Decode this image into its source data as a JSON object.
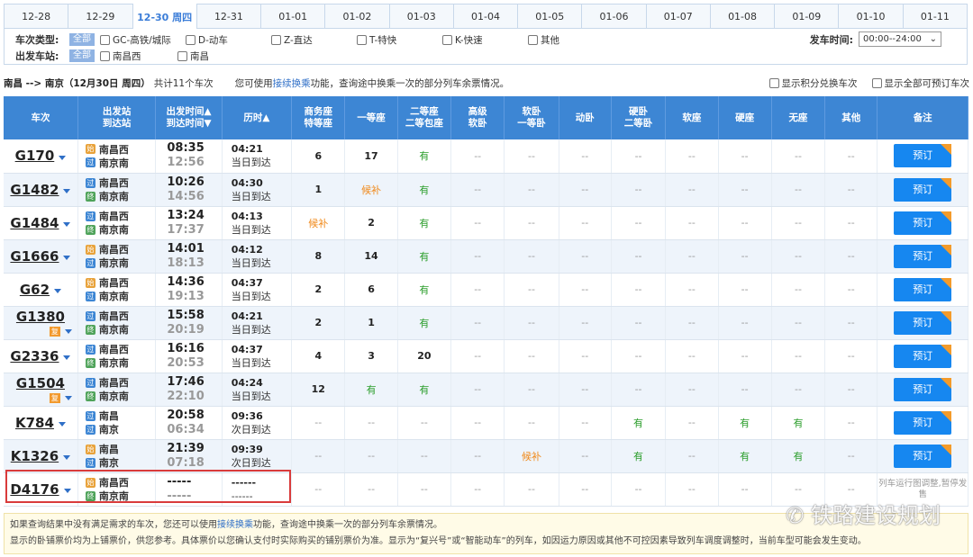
{
  "dates": [
    "12-28",
    "12-29",
    "12-30 周四",
    "12-31",
    "01-01",
    "01-02",
    "01-03",
    "01-04",
    "01-05",
    "01-06",
    "01-07",
    "01-08",
    "01-09",
    "01-10",
    "01-11"
  ],
  "filters": {
    "type_label": "车次类型:",
    "all": "全部",
    "types": [
      "GC-高铁/城际",
      "D-动车",
      "Z-直达",
      "T-特快",
      "K-快速",
      "其他"
    ],
    "station_label": "出发车站:",
    "stations": [
      "南昌西",
      "南昌"
    ],
    "time_label": "发车时间:",
    "time_value": "00:00--24:00"
  },
  "summary": {
    "route": "南昌 --> 南京（12月30日 周四）",
    "count": "共计11个车次",
    "hint_pre": "您可使用",
    "hint_link": "接续换乘",
    "hint_post": "功能，查询途中换乘一次的部分列车余票情况。",
    "opt1": "显示积分兑换车次",
    "opt2": "显示全部可预订车次"
  },
  "headers": {
    "train": "车次",
    "station1": "出发站",
    "station2": "到达站",
    "time1": "出发时间▲",
    "time2": "到达时间▼",
    "dur": "历时▲",
    "biz1": "商务座",
    "biz2": "特等座",
    "first": "一等座",
    "second1": "二等座",
    "second2": "二等包座",
    "gr1": "高级",
    "gr2": "软卧",
    "rw1": "软卧",
    "rw2": "一等卧",
    "dw": "动卧",
    "yw1": "硬卧",
    "yw2": "二等卧",
    "rz": "软座",
    "yz": "硬座",
    "wz": "无座",
    "qt": "其他",
    "note": "备注"
  },
  "book_label": "预订",
  "rows": [
    {
      "train": "G170",
      "fu": "",
      "from": "南昌西",
      "to": "南京南",
      "fb": "始",
      "tb": "过",
      "dep": "08:35",
      "arr": "12:56",
      "dur": "04:21",
      "day": "当日到达",
      "seats": [
        "6",
        "17",
        "有",
        "--",
        "--",
        "--",
        "--",
        "--",
        "--",
        "--",
        "--"
      ],
      "note": ""
    },
    {
      "train": "G1482",
      "fu": "",
      "from": "南昌西",
      "to": "南京南",
      "fb": "过",
      "tb": "终",
      "dep": "10:26",
      "arr": "14:56",
      "dur": "04:30",
      "day": "当日到达",
      "seats": [
        "1",
        "候补",
        "有",
        "--",
        "--",
        "--",
        "--",
        "--",
        "--",
        "--",
        "--"
      ],
      "note": ""
    },
    {
      "train": "G1484",
      "fu": "",
      "from": "南昌西",
      "to": "南京南",
      "fb": "过",
      "tb": "终",
      "dep": "13:24",
      "arr": "17:37",
      "dur": "04:13",
      "day": "当日到达",
      "seats": [
        "候补",
        "2",
        "有",
        "--",
        "--",
        "--",
        "--",
        "--",
        "--",
        "--",
        "--"
      ],
      "note": ""
    },
    {
      "train": "G1666",
      "fu": "",
      "from": "南昌西",
      "to": "南京南",
      "fb": "始",
      "tb": "过",
      "dep": "14:01",
      "arr": "18:13",
      "dur": "04:12",
      "day": "当日到达",
      "seats": [
        "8",
        "14",
        "有",
        "--",
        "--",
        "--",
        "--",
        "--",
        "--",
        "--",
        "--"
      ],
      "note": ""
    },
    {
      "train": "G62",
      "fu": "",
      "from": "南昌西",
      "to": "南京南",
      "fb": "始",
      "tb": "过",
      "dep": "14:36",
      "arr": "19:13",
      "dur": "04:37",
      "day": "当日到达",
      "seats": [
        "2",
        "6",
        "有",
        "--",
        "--",
        "--",
        "--",
        "--",
        "--",
        "--",
        "--"
      ],
      "note": ""
    },
    {
      "train": "G1380",
      "fu": "复",
      "from": "南昌西",
      "to": "南京南",
      "fb": "过",
      "tb": "终",
      "dep": "15:58",
      "arr": "20:19",
      "dur": "04:21",
      "day": "当日到达",
      "seats": [
        "2",
        "1",
        "有",
        "--",
        "--",
        "--",
        "--",
        "--",
        "--",
        "--",
        "--"
      ],
      "note": ""
    },
    {
      "train": "G2336",
      "fu": "",
      "from": "南昌西",
      "to": "南京南",
      "fb": "过",
      "tb": "终",
      "dep": "16:16",
      "arr": "20:53",
      "dur": "04:37",
      "day": "当日到达",
      "seats": [
        "4",
        "3",
        "20",
        "--",
        "--",
        "--",
        "--",
        "--",
        "--",
        "--",
        "--"
      ],
      "note": ""
    },
    {
      "train": "G1504",
      "fu": "复",
      "from": "南昌西",
      "to": "南京南",
      "fb": "过",
      "tb": "终",
      "dep": "17:46",
      "arr": "22:10",
      "dur": "04:24",
      "day": "当日到达",
      "seats": [
        "12",
        "有",
        "有",
        "--",
        "--",
        "--",
        "--",
        "--",
        "--",
        "--",
        "--"
      ],
      "note": ""
    },
    {
      "train": "K784",
      "fu": "",
      "from": "南昌",
      "to": "南京",
      "fb": "过",
      "tb": "过",
      "dep": "20:58",
      "arr": "06:34",
      "dur": "09:36",
      "day": "次日到达",
      "seats": [
        "--",
        "--",
        "--",
        "--",
        "--",
        "--",
        "有",
        "--",
        "有",
        "有",
        "--"
      ],
      "note": ""
    },
    {
      "train": "K1326",
      "fu": "",
      "from": "南昌",
      "to": "南京",
      "fb": "始",
      "tb": "过",
      "dep": "21:39",
      "arr": "07:18",
      "dur": "09:39",
      "day": "次日到达",
      "seats": [
        "--",
        "--",
        "--",
        "--",
        "候补",
        "--",
        "有",
        "--",
        "有",
        "有",
        "--"
      ],
      "note": ""
    },
    {
      "train": "D4176",
      "fu": "",
      "from": "南昌西",
      "to": "南京南",
      "fb": "始",
      "tb": "终",
      "dep": "-----",
      "arr": "-----",
      "dur": "------",
      "day": "------",
      "seats": [
        "--",
        "--",
        "--",
        "--",
        "--",
        "--",
        "--",
        "--",
        "--",
        "--",
        "--"
      ],
      "note": "列车运行图调整,暂停发售"
    }
  ],
  "footer": {
    "line1_pre": "如果查询结果中没有满足需求的车次，您还可以使用",
    "line1_link": "接续换乘",
    "line1_post": "功能，查询途中换乘一次的部分列车余票情况。",
    "line2": "显示的卧铺票价均为上铺票价，供您参考。具体票价以您确认支付时实际购买的铺别票价为准。显示为“复兴号”或“智能动车”的列车，如因运力原因或其他不可控因素导致列车调度调整时，当前车型可能会发生变动。"
  },
  "watermark": "铁路建设规划",
  "colors": {
    "header": "#3d86d4",
    "book": "#1687f0",
    "available": "#2a9d2a",
    "waitlist": "#f08a1c",
    "highlight": "#d93b3b"
  }
}
